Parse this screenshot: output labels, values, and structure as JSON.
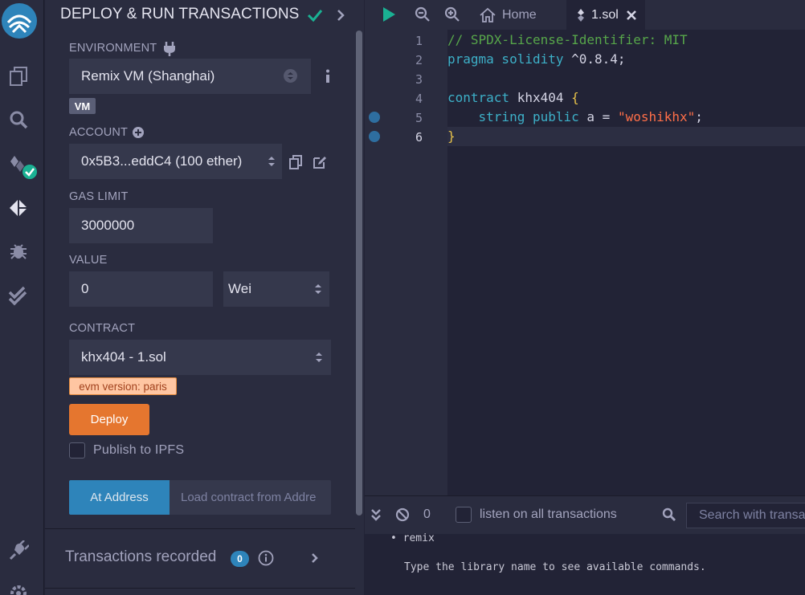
{
  "side_panel": {
    "title": "DEPLOY & RUN TRANSACTIONS",
    "environment": {
      "label": "ENVIRONMENT",
      "value": "Remix VM (Shanghai)",
      "badge": "VM"
    },
    "account": {
      "label": "ACCOUNT",
      "value": "0x5B3...eddC4 (100 ether)"
    },
    "gas_limit": {
      "label": "GAS LIMIT",
      "value": "3000000"
    },
    "value": {
      "label": "VALUE",
      "amount": "0",
      "unit": "Wei"
    },
    "contract": {
      "label": "CONTRACT",
      "value": "khx404 - 1.sol",
      "evm_badge": "evm version: paris"
    },
    "deploy_label": "Deploy",
    "publish_label": "Publish to IPFS",
    "at_address_label": "At Address",
    "at_address_placeholder": "Load contract from Addre",
    "transactions_title": "Transactions recorded",
    "transactions_count": "0"
  },
  "tabs": {
    "home": "Home",
    "file": "1.sol"
  },
  "editor": {
    "line_numbers": [
      "1",
      "2",
      "3",
      "4",
      "5",
      "6"
    ],
    "lines": {
      "l1": "// SPDX-License-Identifier: MIT",
      "l2_kw": "pragma solidity",
      "l2_rest": " ^0.8.4;",
      "l4_kw": "contract",
      "l4_name": " khx404 ",
      "l4_brace": "{",
      "l5_indent": "    ",
      "l5_type": "string public",
      "l5_mid": " a = ",
      "l5_str": "\"woshikhx\"",
      "l5_end": ";",
      "l6_brace": "}"
    }
  },
  "terminal": {
    "count": "0",
    "listen_label": "listen on all transactions",
    "search_placeholder": "Search with transaction hash or address",
    "out_bullet": "remix",
    "out_line": "Type the library name to see available commands."
  },
  "colors": {
    "accent": "#2e84ba",
    "deploy": "#e5762f",
    "success": "#1ab193"
  }
}
